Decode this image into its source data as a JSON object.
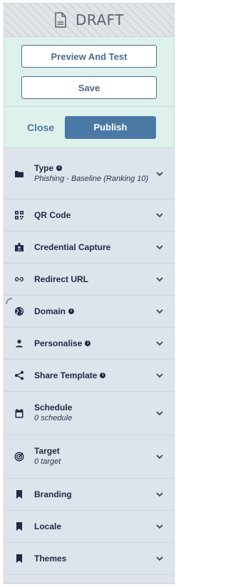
{
  "header": {
    "title": "DRAFT",
    "icon": "document-icon"
  },
  "actions": {
    "preview_label": "Preview And Test",
    "save_label": "Save",
    "close_label": "Close",
    "publish_label": "Publish"
  },
  "menu": [
    {
      "key": "type",
      "label": "Type",
      "info": true,
      "sub": "Phishing - Baseline (Ranking 10)",
      "icon": "folder-icon"
    },
    {
      "key": "qr",
      "label": "QR Code",
      "info": false,
      "sub": "",
      "icon": "qr-code-icon"
    },
    {
      "key": "credential",
      "label": "Credential Capture",
      "info": false,
      "sub": "",
      "icon": "badge-icon"
    },
    {
      "key": "redirect",
      "label": "Redirect URL",
      "info": false,
      "sub": "",
      "icon": "link-icon"
    },
    {
      "key": "domain",
      "label": "Domain",
      "info": true,
      "sub": "",
      "icon": "globe-icon"
    },
    {
      "key": "personalise",
      "label": "Personalise",
      "info": true,
      "sub": "",
      "icon": "person-icon"
    },
    {
      "key": "share",
      "label": "Share Template",
      "info": true,
      "sub": "",
      "icon": "share-icon"
    },
    {
      "key": "schedule",
      "label": "Schedule",
      "info": false,
      "sub": "0 schedule",
      "icon": "calendar-icon"
    },
    {
      "key": "target",
      "label": "Target",
      "info": false,
      "sub": "0 target",
      "icon": "target-icon"
    },
    {
      "key": "branding",
      "label": "Branding",
      "info": false,
      "sub": "",
      "icon": "bookmark-icon"
    },
    {
      "key": "locale",
      "label": "Locale",
      "info": false,
      "sub": "",
      "icon": "bookmark-icon"
    },
    {
      "key": "themes",
      "label": "Themes",
      "info": false,
      "sub": "",
      "icon": "bookmark-icon"
    }
  ],
  "colors": {
    "primary": "#4a79a6",
    "panel_bg": "#dde4ec",
    "action_bg": "#dff1ec",
    "text_dark": "#1f2a44"
  }
}
